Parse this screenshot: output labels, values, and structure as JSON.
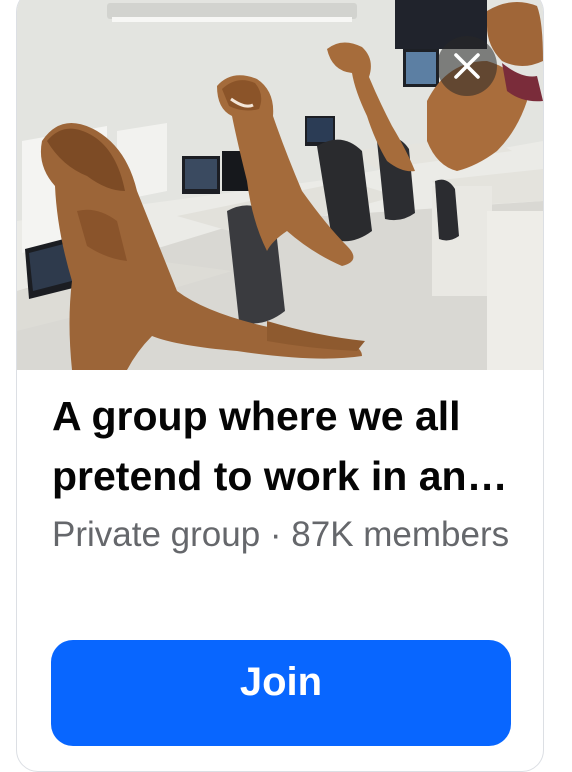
{
  "group_card": {
    "cover_image": "office photo with people in inflatable t-rex costumes sitting at desks",
    "close_icon": "close-icon",
    "title": "A group where we all pretend to work in an office",
    "privacy": "Private group",
    "separator": " · ",
    "members": "87K members",
    "join_label": "Join"
  },
  "colors": {
    "primary": "#0866ff",
    "title_text": "#050505",
    "secondary_text": "#65676b",
    "card_border": "#dcdfe4"
  }
}
